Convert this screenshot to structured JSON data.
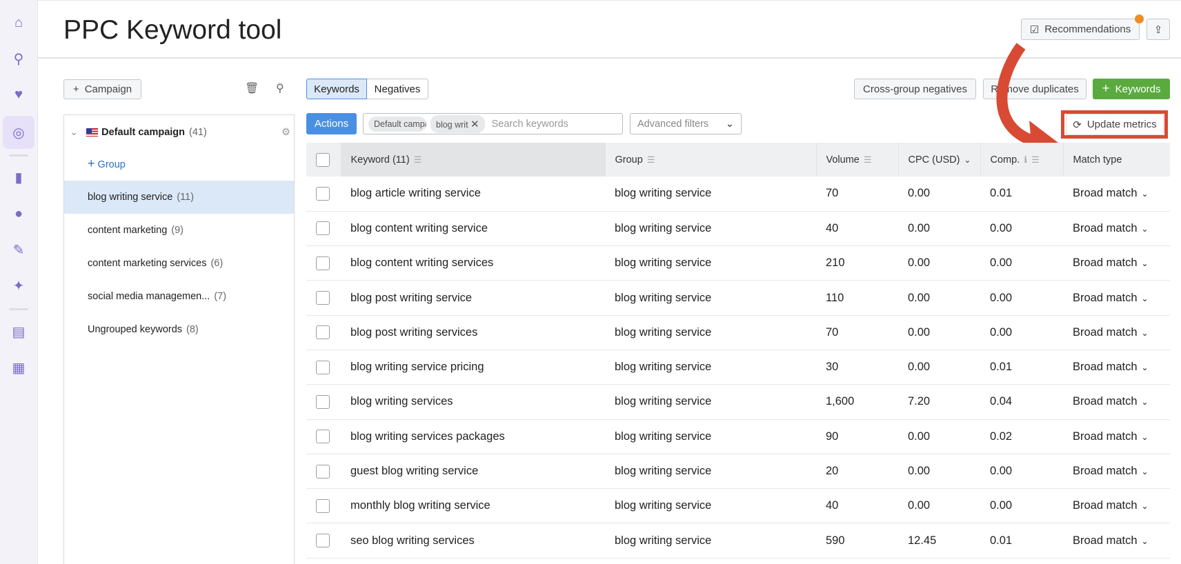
{
  "page": {
    "title": "PPC Keyword tool"
  },
  "sidebar": {
    "icons": [
      "home-icon",
      "search-insights-icon",
      "heart-chat-icon",
      "ppc-target-icon",
      "bar-chart-icon",
      "location-pin-icon",
      "edit-icon",
      "sparkle-trend-icon",
      "document-icon",
      "apps-icon"
    ]
  },
  "header": {
    "recommendations": "Recommendations",
    "accent_dot": "#f28c28"
  },
  "left": {
    "campaign_button": "Campaign",
    "campaign": {
      "name": "Default campaign",
      "count": "(41)"
    },
    "add_group": "Group",
    "groups": [
      {
        "name": "blog writing service",
        "count": "(11)"
      },
      {
        "name": "content marketing",
        "count": "(9)"
      },
      {
        "name": "content marketing services",
        "count": "(6)"
      },
      {
        "name": "social media managemen...",
        "count": "(7)"
      },
      {
        "name": "Ungrouped keywords",
        "count": "(8)"
      }
    ]
  },
  "toolbar": {
    "tabs": [
      "Keywords",
      "Negatives"
    ],
    "cross_group": "Cross-group negatives",
    "remove_dup": "Remove duplicates",
    "add_keywords": "Keywords",
    "actions": "Actions",
    "chips": [
      "Default campa",
      "blog writ"
    ],
    "search_placeholder": "Search keywords",
    "advanced_filters": "Advanced filters",
    "update_metrics": "Update metrics"
  },
  "table": {
    "headers": [
      "Keyword (11)",
      "Group",
      "Volume",
      "CPC (USD)",
      "Comp.",
      "Match type"
    ],
    "rows": [
      [
        "blog article writing service",
        "blog writing service",
        "70",
        "0.00",
        "0.01",
        "Broad match"
      ],
      [
        "blog content writing service",
        "blog writing service",
        "40",
        "0.00",
        "0.00",
        "Broad match"
      ],
      [
        "blog content writing services",
        "blog writing service",
        "210",
        "0.00",
        "0.00",
        "Broad match"
      ],
      [
        "blog post writing service",
        "blog writing service",
        "110",
        "0.00",
        "0.00",
        "Broad match"
      ],
      [
        "blog post writing services",
        "blog writing service",
        "70",
        "0.00",
        "0.00",
        "Broad match"
      ],
      [
        "blog writing service pricing",
        "blog writing service",
        "30",
        "0.00",
        "0.01",
        "Broad match"
      ],
      [
        "blog writing services",
        "blog writing service",
        "1,600",
        "7.20",
        "0.04",
        "Broad match"
      ],
      [
        "blog writing services packages",
        "blog writing service",
        "90",
        "0.00",
        "0.02",
        "Broad match"
      ],
      [
        "guest blog writing service",
        "blog writing service",
        "20",
        "0.00",
        "0.00",
        "Broad match"
      ],
      [
        "monthly blog writing service",
        "blog writing service",
        "40",
        "0.00",
        "0.00",
        "Broad match"
      ],
      [
        "seo blog writing services",
        "blog writing service",
        "590",
        "12.45",
        "0.01",
        "Broad match"
      ]
    ]
  },
  "colors": {
    "primary": "#4a90e2",
    "green": "#5aaa3f",
    "annotation": "#d84a34",
    "selected_group": "#dbe8f7"
  }
}
